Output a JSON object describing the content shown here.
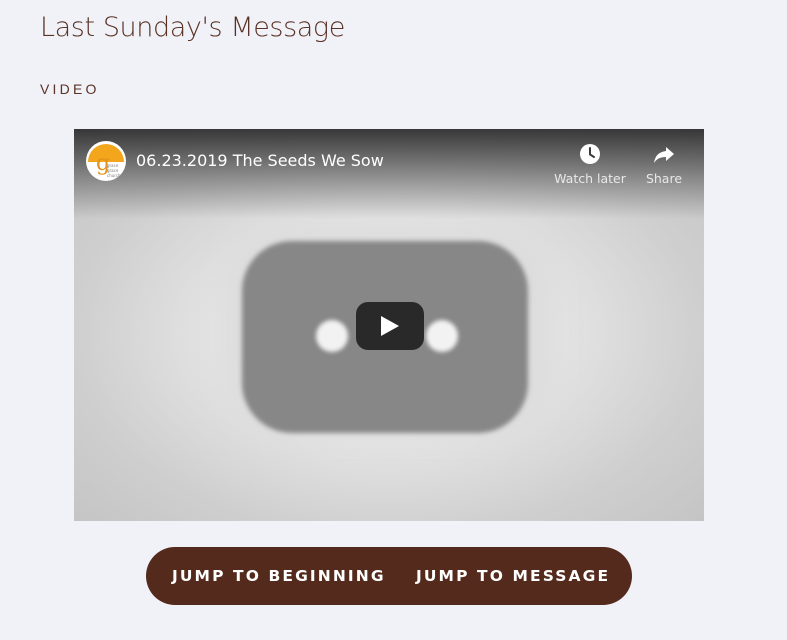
{
  "page": {
    "title": "Last Sunday's Message",
    "section_label": "VIDEO"
  },
  "video": {
    "title": "06.23.2019 The Seeds We Sow",
    "channel_logo": {
      "letter": "g",
      "text": "grace\ngrace\nchurch",
      "icon": "umbrella-logo-icon",
      "color": "#f3a51c"
    },
    "controls": {
      "watch_later": {
        "label": "Watch later",
        "icon": "clock-icon"
      },
      "share": {
        "label": "Share",
        "icon": "share-arrow-icon"
      }
    },
    "play_icon": "play-icon"
  },
  "jump_buttons": {
    "beginning_label": "JUMP TO BEGINNING",
    "message_label": "JUMP TO MESSAGE",
    "background": "#542a1c"
  }
}
